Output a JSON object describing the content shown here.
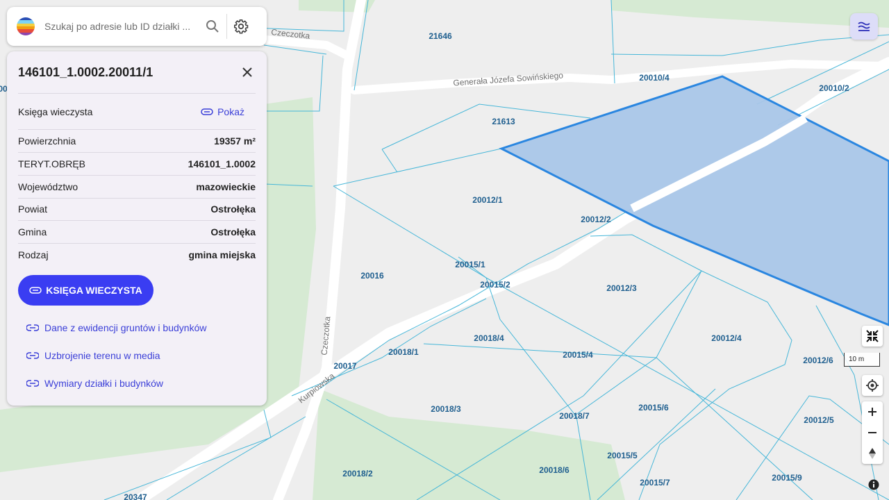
{
  "map": {
    "streets": {
      "sowinskiego": "Generała Józefa Sowińskiego",
      "czeczotka_top": "Czeczotka",
      "czeczotka_side": "Czeczotka",
      "kurpiowska": "Kurpiowska"
    },
    "parcels": [
      "21646",
      "20010/4",
      "20010/2",
      "21613",
      "20012/1",
      "20012/2",
      "20015/1",
      "20015/2",
      "20016",
      "20012/3",
      "20018/4",
      "20015/4",
      "20012/4",
      "20017",
      "20018/1",
      "20012/6",
      "20018/3",
      "20018/7",
      "20015/6",
      "20012/5",
      "20015/5",
      "20018/6",
      "20015/7",
      "20018/2",
      "20015/9",
      "20347"
    ],
    "edge_label": "00",
    "scale": "10 m",
    "colors": {
      "parcel_line": "#45b6d8",
      "selected_fill": "#a9c6e8",
      "selected_stroke": "#2a86e0",
      "green": "#d6ead3",
      "background": "#eeeeee"
    }
  },
  "search": {
    "placeholder": "Szukaj po adresie lub ID działki ..."
  },
  "panel": {
    "title": "146101_1.0002.20011/1",
    "kw_label": "Księga wieczysta",
    "kw_show": "Pokaż",
    "rows": [
      {
        "label": "Powierzchnia",
        "value": "19357 m²"
      },
      {
        "label": "TERYT.OBRĘB",
        "value": "146101_1.0002"
      },
      {
        "label": "Województwo",
        "value": "mazowieckie"
      },
      {
        "label": "Powiat",
        "value": "Ostrołęka"
      },
      {
        "label": "Gmina",
        "value": "Ostrołęka"
      },
      {
        "label": "Rodzaj",
        "value": "gmina miejska"
      }
    ],
    "button": "KSIĘGA WIECZYSTA",
    "links": [
      "Dane z ewidencji gruntów i budynków",
      "Uzbrojenie terenu w media",
      "Wymiary działki i budynków"
    ]
  },
  "icons": [
    "logo-icon",
    "search-icon",
    "gear-icon",
    "close-icon",
    "paperclip-icon",
    "link-icon",
    "layers-icon",
    "fullscreen-exit-icon",
    "locate-icon",
    "zoom-in-icon",
    "zoom-out-icon",
    "compass-icon",
    "info-icon"
  ]
}
